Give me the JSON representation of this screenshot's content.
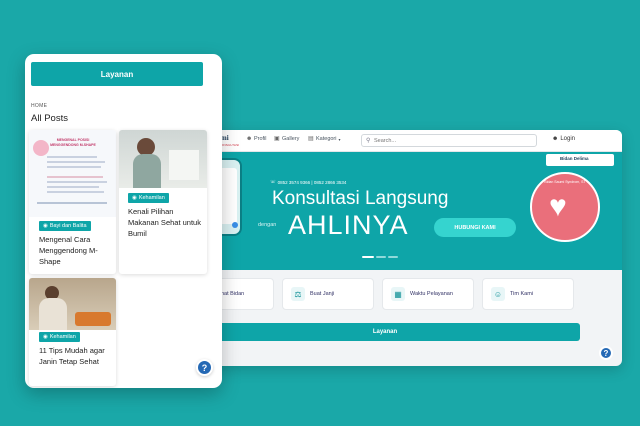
{
  "desktop": {
    "logo": "m Saumi",
    "logo_sub": "ANSI DAN KONSULTASI",
    "menu": [
      {
        "label": "Profil",
        "icon": "user-icon"
      },
      {
        "label": "Gallery",
        "icon": "image-icon"
      },
      {
        "label": "Kategori",
        "icon": "folder-icon"
      }
    ],
    "search_placeholder": "Search...",
    "login_label": "Login",
    "hero": {
      "contact": "0852 3574 9366  |  0852 2866 3534",
      "title_line1": "Konsultasi Langsung",
      "dengan": "dengan",
      "title_line2": "AHLINYA",
      "button": "HUBUNGI KAMI",
      "brand": "Bidan Delima",
      "badge_text": "Bidan Saumi Syndrom, ST"
    },
    "services": [
      {
        "label": "Chat Bidan",
        "icon": "chat-icon"
      },
      {
        "label": "Buat Janji",
        "icon": "calendar-doctor-icon"
      },
      {
        "label": "Waktu Pelayanan",
        "icon": "calendar-icon"
      },
      {
        "label": "Tim Kami",
        "icon": "team-icon"
      }
    ],
    "layanan_label": "Layanan",
    "help": "?"
  },
  "mobile": {
    "header": "Layanan",
    "breadcrumb": "HOME",
    "title": "All Posts",
    "posts": [
      {
        "tag": "Bayi dan Balita",
        "title": "Mengenal Cara Menggendong M-Shape",
        "image_title": "MENGENAL POSISI MENGGENDONG M-SHAPE"
      },
      {
        "tag": "Kehamilan",
        "title": "Kenali Pilihan Makanan Sehat untuk Bumil"
      },
      {
        "tag": "Kehamilan",
        "title": "11 Tips Mudah agar Janin Tetap Sehat"
      }
    ],
    "help": "?"
  },
  "colors": {
    "background": "#1aa8a8",
    "primary": "#0ea5a8",
    "help_button": "#2569b5"
  }
}
